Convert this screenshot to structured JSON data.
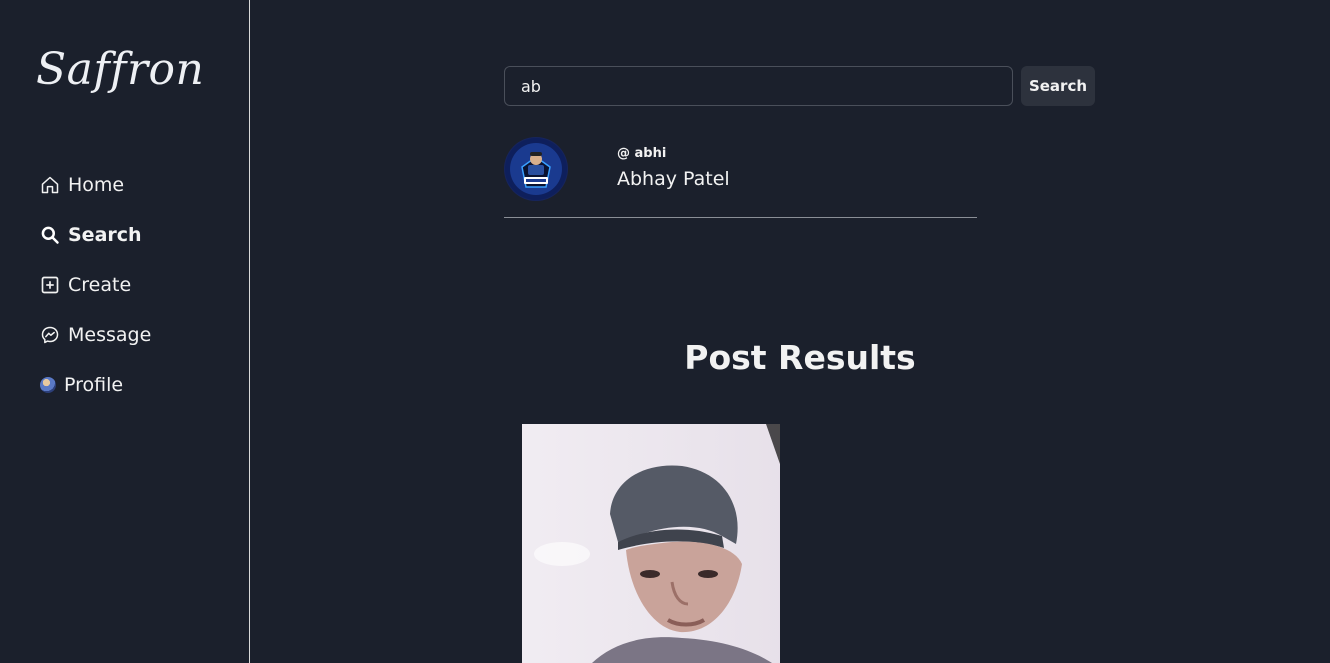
{
  "sidebar": {
    "logo": "Saffron",
    "items": [
      {
        "label": "Home",
        "icon": "home-icon"
      },
      {
        "label": "Search",
        "icon": "search-icon"
      },
      {
        "label": "Create",
        "icon": "plus-square-icon"
      },
      {
        "label": "Message",
        "icon": "messenger-icon"
      },
      {
        "label": "Profile",
        "icon": "avatar"
      }
    ]
  },
  "search": {
    "value": "ab",
    "button_label": "Search"
  },
  "users": [
    {
      "username": "@ abhi",
      "full_name": "Abhay Patel"
    }
  ],
  "posts": {
    "title": "Post Results"
  },
  "colors": {
    "background": "#1b202c",
    "button": "#2d323d",
    "text": "#f2f2f2"
  }
}
